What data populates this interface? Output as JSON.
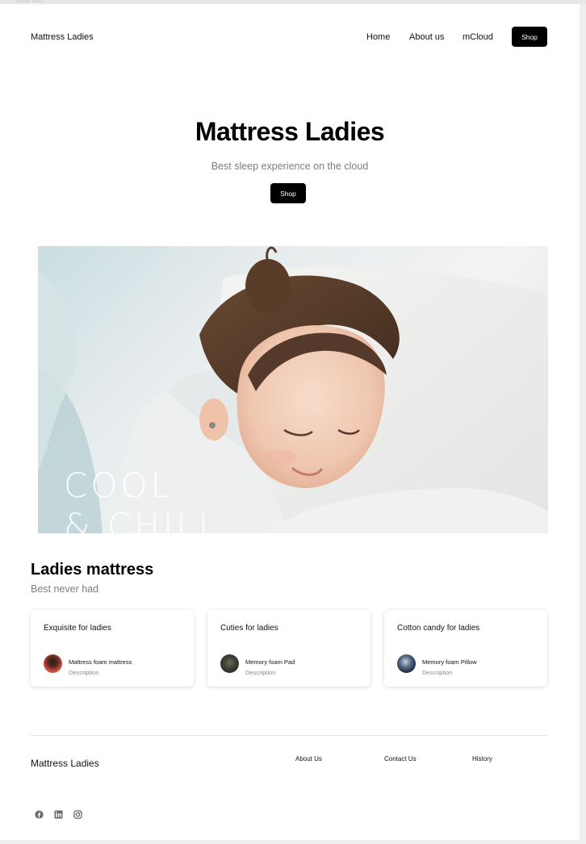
{
  "header": {
    "brand": "Mattress Ladies",
    "nav": [
      "Home",
      "About us",
      "mCloud"
    ],
    "shop_label": "Shop"
  },
  "hero": {
    "title": "Mattress Ladies",
    "subtitle": "Best sleep experience on the cloud",
    "shop_label": "Shop",
    "image_overlay": [
      "COOL",
      "& CHILL"
    ]
  },
  "section": {
    "title": "Ladies mattress",
    "subtitle": "Best never had",
    "cards": [
      {
        "title": "Exquisite for ladies",
        "name": "Mattress foam mattress",
        "desc": "Description"
      },
      {
        "title": "Cuties for ladies",
        "name": "Memory foam Pad",
        "desc": "Description"
      },
      {
        "title": "Cotton candy for ladies",
        "name": "Memory foam Pillow",
        "desc": "Description"
      }
    ]
  },
  "footer": {
    "brand": "Mattress Ladies",
    "links": [
      "About Us",
      "Contact Us",
      "History"
    ],
    "social_icons": [
      "facebook-icon",
      "linkedin-icon",
      "instagram-icon"
    ]
  },
  "colors": {
    "button": "#000000",
    "muted_text": "#7d7d7d",
    "background": "#ffffff"
  }
}
